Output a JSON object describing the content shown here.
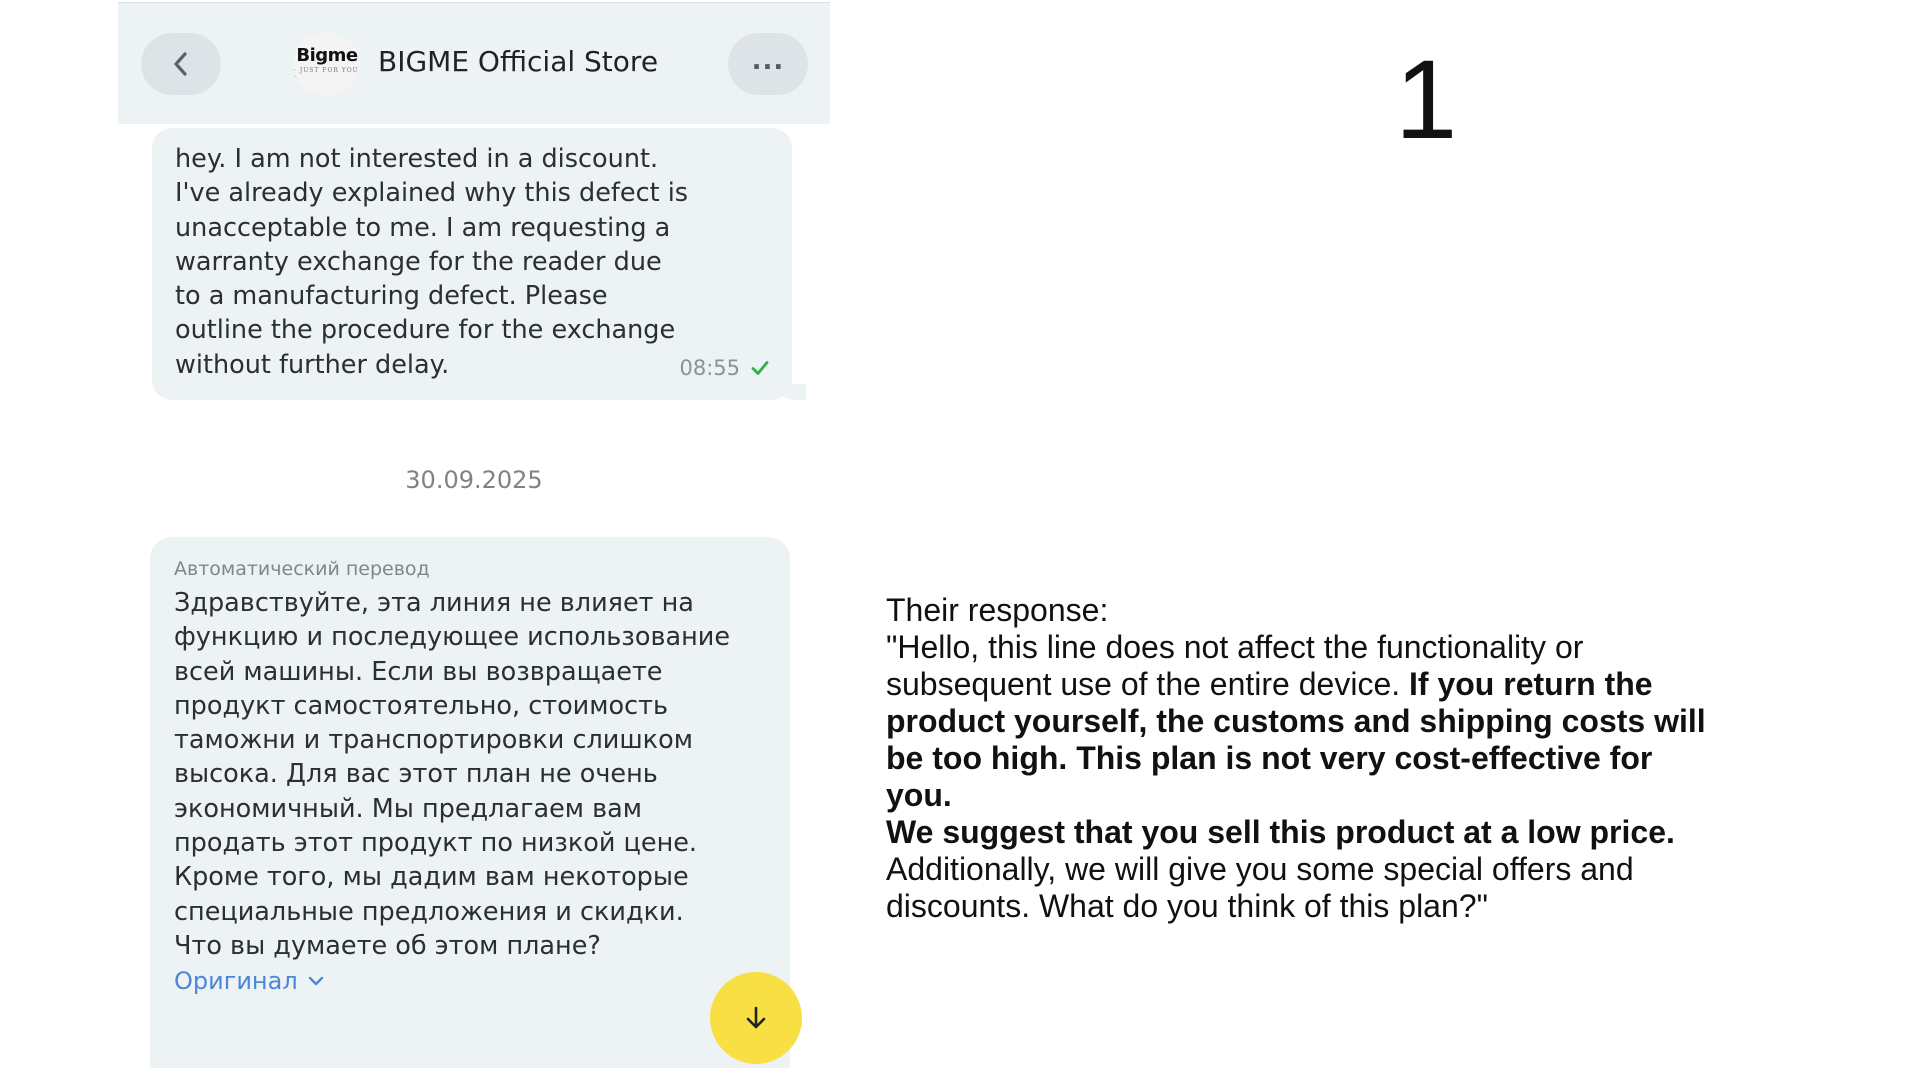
{
  "chat": {
    "header": {
      "store_name": "BIGME Official Store",
      "logo_text": "Bigme",
      "logo_tagline": "· JUST FOR YOU ·",
      "more_label": "...",
      "back_icon": "chevron-left-icon"
    },
    "outgoing_message": {
      "text": "hey. I am not interested in a discount. I've already explained why this defect is unacceptable to me. I am requesting a warranty exchange for the reader due to a manufacturing defect. Please outline the procedure for the exchange without further delay.",
      "time": "08:55",
      "status_icon": "checkmark-icon",
      "status_color": "#2bb34b"
    },
    "date_divider": "30.09.2025",
    "incoming_message": {
      "auto_translate_label": "Автоматический перевод",
      "text": "Здравствуйте, эта линия не влияет на функцию и последующее использование всей машины. Если вы возвращаете продукт самостоятельно, стоимость таможни и транспортировки слишком высока. Для вас этот план не очень экономичный. Мы предлагаем вам продать этот продукт по низкой цене. Кроме того, мы дадим вам некоторые специальные предложения и скидки. Что вы думаете об этом плане?",
      "original_link": "Оригинал"
    },
    "scroll_button_icon": "arrow-down-icon",
    "scroll_button_color": "#f8df43"
  },
  "annotation": {
    "slide_number": "1",
    "heading": "Their response:",
    "quote_part1": "\"Hello, this line does not affect the functionality or subsequent use of the entire device.",
    "quote_bold1": "If you return the product yourself, the customs and shipping costs will be too high. This plan is not very cost-effective for you.",
    "quote_bold2": "We suggest that you sell this product at a low price.",
    "quote_part2": "Additionally, we will give you some special offers and discounts. What do you think of this plan?\""
  }
}
